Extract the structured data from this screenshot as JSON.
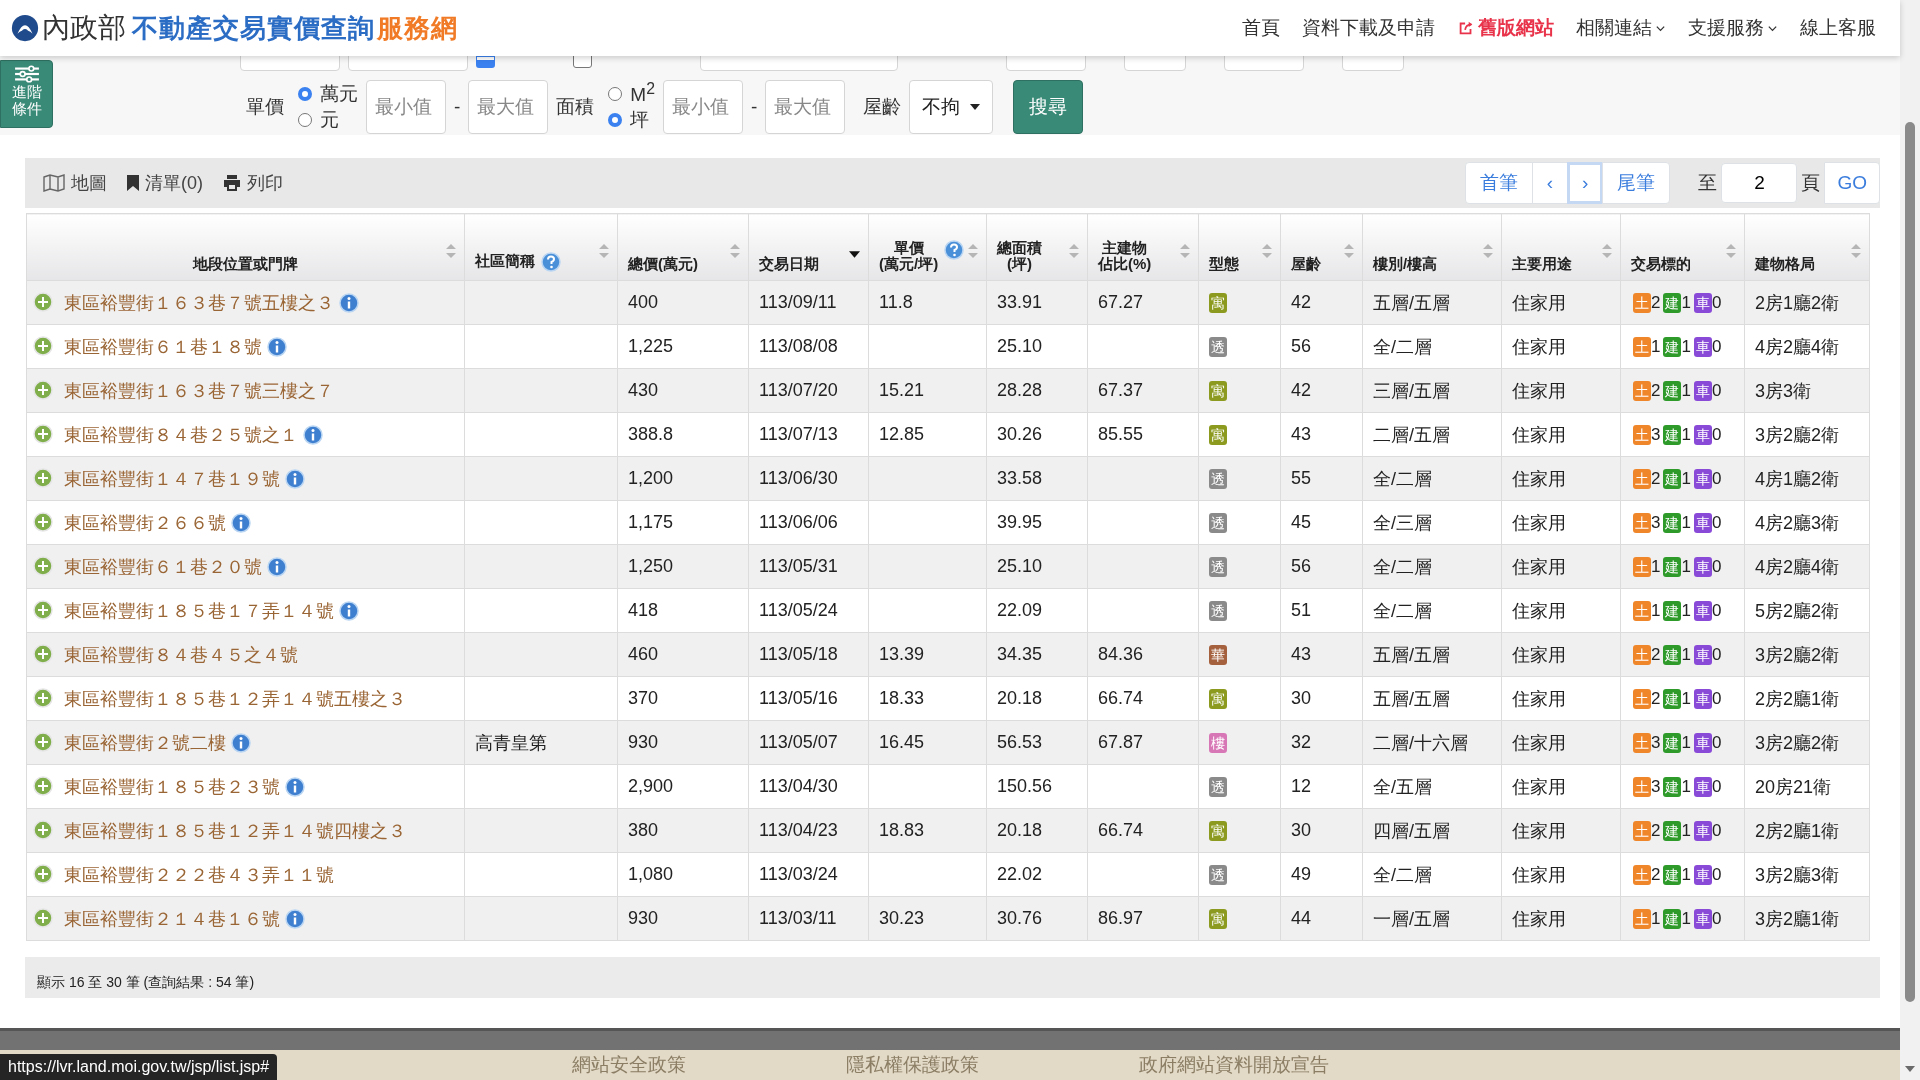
{
  "header": {
    "agency": "內政部",
    "title": "不動產交易實價查詢",
    "suffix": "服務網",
    "nav": [
      {
        "label": "首頁",
        "kind": "plain"
      },
      {
        "label": "資料下載及申請",
        "kind": "plain"
      },
      {
        "label": "舊版網站",
        "kind": "external"
      },
      {
        "label": "相關連結",
        "kind": "dropdown"
      },
      {
        "label": "支援服務",
        "kind": "dropdown"
      },
      {
        "label": "線上客服",
        "kind": "plain"
      }
    ]
  },
  "advanced_button": {
    "label": "進階條件"
  },
  "search": {
    "row1": {
      "checkboxes": [
        {
          "checked": true
        },
        {
          "checked": false
        }
      ]
    },
    "unit_price": {
      "label": "單價",
      "options": [
        {
          "label": "萬元",
          "selected": true
        },
        {
          "label": "元",
          "selected": false
        }
      ],
      "min_placeholder": "最小值",
      "dash": "-",
      "max_placeholder": "最大值"
    },
    "area": {
      "label": "面積",
      "options": [
        {
          "label": "M$^{2}$",
          "selected": false
        },
        {
          "label": "坪",
          "selected": true
        }
      ],
      "min_placeholder": "最小值",
      "dash": "-",
      "max_placeholder": "最大值"
    },
    "age": {
      "label": "屋齡",
      "value": "不拘"
    },
    "button": "搜尋"
  },
  "toolbar": [
    {
      "label": "地圖",
      "kind": "map"
    },
    {
      "label": "清單(0)",
      "kind": "bookmark"
    },
    {
      "label": "列印",
      "kind": "print"
    }
  ],
  "pagination": {
    "buttons": [
      {
        "label": "首筆",
        "focused": false
      },
      {
        "label": "‹",
        "focused": false
      },
      {
        "label": "›",
        "focused": true
      },
      {
        "label": "尾筆",
        "focused": false
      }
    ],
    "goto_label": "至",
    "page_value": "2",
    "page_unit": "頁",
    "go": "GO"
  },
  "table": {
    "columns": [
      {
        "lines": [
          "地段位置或門牌"
        ],
        "help": false,
        "sorted": false
      },
      {
        "lines": [
          "社區簡稱"
        ],
        "help": true,
        "sorted": false
      },
      {
        "lines": [
          "總價(萬元)"
        ],
        "help": false,
        "sorted": false
      },
      {
        "lines": [
          "交易日期"
        ],
        "help": false,
        "sorted": true
      },
      {
        "lines": [
          "單價",
          "(萬元/坪)"
        ],
        "help": true,
        "sorted": false
      },
      {
        "lines": [
          "總面積",
          "(坪)"
        ],
        "help": false,
        "sorted": false
      },
      {
        "lines": [
          "主建物",
          "佔比(%)"
        ],
        "help": false,
        "sorted": false
      },
      {
        "lines": [
          "型態"
        ],
        "help": false,
        "sorted": false
      },
      {
        "lines": [
          "屋齡"
        ],
        "help": false,
        "sorted": false
      },
      {
        "lines": [
          "樓別/樓高"
        ],
        "help": false,
        "sorted": false
      },
      {
        "lines": [
          "主要用途"
        ],
        "help": false,
        "sorted": false
      },
      {
        "lines": [
          "交易標的"
        ],
        "help": false,
        "sorted": false
      },
      {
        "lines": [
          "建物格局"
        ],
        "help": false,
        "sorted": false
      }
    ],
    "rows": [
      {
        "address": "東區裕豐街１６３巷７號五樓之３",
        "info": true,
        "total": "400",
        "date": "113/09/11",
        "unit_price": "11.8",
        "area": "33.91",
        "main_ratio": "67.27",
        "type": {
          "label": "寓",
          "color": "#8c9b1f"
        },
        "age": "42",
        "floors": "五層/五層",
        "use": "住家用",
        "targets": [
          {
            "label": "土",
            "count": "2",
            "color": "#f0862a"
          },
          {
            "label": "建",
            "count": "1",
            "color": "#2e9a2a"
          },
          {
            "label": "車",
            "count": "0",
            "color": "#8a4ad8"
          }
        ],
        "layout": "2房1廳2衛"
      },
      {
        "address": "東區裕豐街６１巷１８號",
        "info": true,
        "total": "1,225",
        "date": "113/08/08",
        "area": "25.10",
        "type": {
          "label": "透",
          "color": "#8a8a8a"
        },
        "age": "56",
        "floors": "全/二層",
        "use": "住家用",
        "targets": [
          {
            "label": "土",
            "count": "1",
            "color": "#f0862a"
          },
          {
            "label": "建",
            "count": "1",
            "color": "#2e9a2a"
          },
          {
            "label": "車",
            "count": "0",
            "color": "#8a4ad8"
          }
        ],
        "layout": "4房2廳4衛"
      },
      {
        "address": "東區裕豐街１６３巷７號三樓之７",
        "info": false,
        "total": "430",
        "date": "113/07/20",
        "unit_price": "15.21",
        "area": "28.28",
        "main_ratio": "67.37",
        "type": {
          "label": "寓",
          "color": "#8c9b1f"
        },
        "age": "42",
        "floors": "三層/五層",
        "use": "住家用",
        "targets": [
          {
            "label": "土",
            "count": "2",
            "color": "#f0862a"
          },
          {
            "label": "建",
            "count": "1",
            "color": "#2e9a2a"
          },
          {
            "label": "車",
            "count": "0",
            "color": "#8a4ad8"
          }
        ],
        "layout": "3房3衛"
      },
      {
        "address": "東區裕豐街８４巷２５號之１",
        "info": true,
        "total": "388.8",
        "date": "113/07/13",
        "unit_price": "12.85",
        "area": "30.26",
        "main_ratio": "85.55",
        "type": {
          "label": "寓",
          "color": "#8c9b1f"
        },
        "age": "43",
        "floors": "二層/五層",
        "use": "住家用",
        "targets": [
          {
            "label": "土",
            "count": "3",
            "color": "#f0862a"
          },
          {
            "label": "建",
            "count": "1",
            "color": "#2e9a2a"
          },
          {
            "label": "車",
            "count": "0",
            "color": "#8a4ad8"
          }
        ],
        "layout": "3房2廳2衛"
      },
      {
        "address": "東區裕豐街１４７巷１９號",
        "info": true,
        "total": "1,200",
        "date": "113/06/30",
        "area": "33.58",
        "type": {
          "label": "透",
          "color": "#8a8a8a"
        },
        "age": "55",
        "floors": "全/二層",
        "use": "住家用",
        "targets": [
          {
            "label": "土",
            "count": "2",
            "color": "#f0862a"
          },
          {
            "label": "建",
            "count": "1",
            "color": "#2e9a2a"
          },
          {
            "label": "車",
            "count": "0",
            "color": "#8a4ad8"
          }
        ],
        "layout": "4房1廳2衛"
      },
      {
        "address": "東區裕豐街２６６號",
        "info": true,
        "total": "1,175",
        "date": "113/06/06",
        "area": "39.95",
        "type": {
          "label": "透",
          "color": "#8a8a8a"
        },
        "age": "45",
        "floors": "全/三層",
        "use": "住家用",
        "targets": [
          {
            "label": "土",
            "count": "3",
            "color": "#f0862a"
          },
          {
            "label": "建",
            "count": "1",
            "color": "#2e9a2a"
          },
          {
            "label": "車",
            "count": "0",
            "color": "#8a4ad8"
          }
        ],
        "layout": "4房2廳3衛"
      },
      {
        "address": "東區裕豐街６１巷２０號",
        "info": true,
        "total": "1,250",
        "date": "113/05/31",
        "area": "25.10",
        "type": {
          "label": "透",
          "color": "#8a8a8a"
        },
        "age": "56",
        "floors": "全/二層",
        "use": "住家用",
        "targets": [
          {
            "label": "土",
            "count": "1",
            "color": "#f0862a"
          },
          {
            "label": "建",
            "count": "1",
            "color": "#2e9a2a"
          },
          {
            "label": "車",
            "count": "0",
            "color": "#8a4ad8"
          }
        ],
        "layout": "4房2廳4衛"
      },
      {
        "address": "東區裕豐街１８５巷１７弄１４號",
        "info": true,
        "total": "418",
        "date": "113/05/24",
        "area": "22.09",
        "type": {
          "label": "透",
          "color": "#8a8a8a"
        },
        "age": "51",
        "floors": "全/二層",
        "use": "住家用",
        "targets": [
          {
            "label": "土",
            "count": "1",
            "color": "#f0862a"
          },
          {
            "label": "建",
            "count": "1",
            "color": "#2e9a2a"
          },
          {
            "label": "車",
            "count": "0",
            "color": "#8a4ad8"
          }
        ],
        "layout": "5房2廳2衛"
      },
      {
        "address": "東區裕豐街８４巷４５之４號",
        "info": false,
        "total": "460",
        "date": "113/05/18",
        "unit_price": "13.39",
        "area": "34.35",
        "main_ratio": "84.36",
        "type": {
          "label": "華",
          "color": "#a5613e"
        },
        "age": "43",
        "floors": "五層/五層",
        "use": "住家用",
        "targets": [
          {
            "label": "土",
            "count": "2",
            "color": "#f0862a"
          },
          {
            "label": "建",
            "count": "1",
            "color": "#2e9a2a"
          },
          {
            "label": "車",
            "count": "0",
            "color": "#8a4ad8"
          }
        ],
        "layout": "3房2廳2衛"
      },
      {
        "address": "東區裕豐街１８５巷１２弄１４號五樓之３",
        "info": false,
        "total": "370",
        "date": "113/05/16",
        "unit_price": "18.33",
        "area": "20.18",
        "main_ratio": "66.74",
        "type": {
          "label": "寓",
          "color": "#8c9b1f"
        },
        "age": "30",
        "floors": "五層/五層",
        "use": "住家用",
        "targets": [
          {
            "label": "土",
            "count": "2",
            "color": "#f0862a"
          },
          {
            "label": "建",
            "count": "1",
            "color": "#2e9a2a"
          },
          {
            "label": "車",
            "count": "0",
            "color": "#8a4ad8"
          }
        ],
        "layout": "2房2廳1衛"
      },
      {
        "address": "東區裕豐街２號二樓",
        "info": true,
        "community": "高青皇第",
        "total": "930",
        "date": "113/05/07",
        "unit_price": "16.45",
        "area": "56.53",
        "main_ratio": "67.87",
        "type": {
          "label": "樓",
          "color": "#d877b6"
        },
        "age": "32",
        "floors": "二層/十六層",
        "use": "住家用",
        "targets": [
          {
            "label": "土",
            "count": "3",
            "color": "#f0862a"
          },
          {
            "label": "建",
            "count": "1",
            "color": "#2e9a2a"
          },
          {
            "label": "車",
            "count": "0",
            "color": "#8a4ad8"
          }
        ],
        "layout": "3房2廳2衛"
      },
      {
        "address": "東區裕豐街１８５巷２３號",
        "info": true,
        "total": "2,900",
        "date": "113/04/30",
        "area": "150.56",
        "type": {
          "label": "透",
          "color": "#8a8a8a"
        },
        "age": "12",
        "floors": "全/五層",
        "use": "住家用",
        "targets": [
          {
            "label": "土",
            "count": "3",
            "color": "#f0862a"
          },
          {
            "label": "建",
            "count": "1",
            "color": "#2e9a2a"
          },
          {
            "label": "車",
            "count": "0",
            "color": "#8a4ad8"
          }
        ],
        "layout": "20房21衛"
      },
      {
        "address": "東區裕豐街１８５巷１２弄１４號四樓之３",
        "info": false,
        "total": "380",
        "date": "113/04/23",
        "unit_price": "18.83",
        "area": "20.18",
        "main_ratio": "66.74",
        "type": {
          "label": "寓",
          "color": "#8c9b1f"
        },
        "age": "30",
        "floors": "四層/五層",
        "use": "住家用",
        "targets": [
          {
            "label": "土",
            "count": "2",
            "color": "#f0862a"
          },
          {
            "label": "建",
            "count": "1",
            "color": "#2e9a2a"
          },
          {
            "label": "車",
            "count": "0",
            "color": "#8a4ad8"
          }
        ],
        "layout": "2房2廳1衛"
      },
      {
        "address": "東區裕豐街２２２巷４３弄１１號",
        "info": false,
        "total": "1,080",
        "date": "113/03/24",
        "area": "22.02",
        "type": {
          "label": "透",
          "color": "#8a8a8a"
        },
        "age": "49",
        "floors": "全/二層",
        "use": "住家用",
        "targets": [
          {
            "label": "土",
            "count": "2",
            "color": "#f0862a"
          },
          {
            "label": "建",
            "count": "1",
            "color": "#2e9a2a"
          },
          {
            "label": "車",
            "count": "0",
            "color": "#8a4ad8"
          }
        ],
        "layout": "3房2廳3衛"
      },
      {
        "address": "東區裕豐街２１４巷１６號",
        "info": true,
        "total": "930",
        "date": "113/03/11",
        "unit_price": "30.23",
        "area": "30.76",
        "main_ratio": "86.97",
        "type": {
          "label": "寓",
          "color": "#8c9b1f"
        },
        "age": "44",
        "floors": "一層/五層",
        "use": "住家用",
        "targets": [
          {
            "label": "土",
            "count": "1",
            "color": "#f0862a"
          },
          {
            "label": "建",
            "count": "1",
            "color": "#2e9a2a"
          },
          {
            "label": "車",
            "count": "0",
            "color": "#8a4ad8"
          }
        ],
        "layout": "3房2廳1衛"
      }
    ]
  },
  "summary": "顯示 16 至 30 筆 (查詢結果 : 54 筆)",
  "footer_links": [
    "網站安全政策",
    "隱私權保護政策",
    "政府網站資料開放宣告"
  ],
  "status_url": "https://lvr.land.moi.gov.tw/jsp/list.jsp#"
}
